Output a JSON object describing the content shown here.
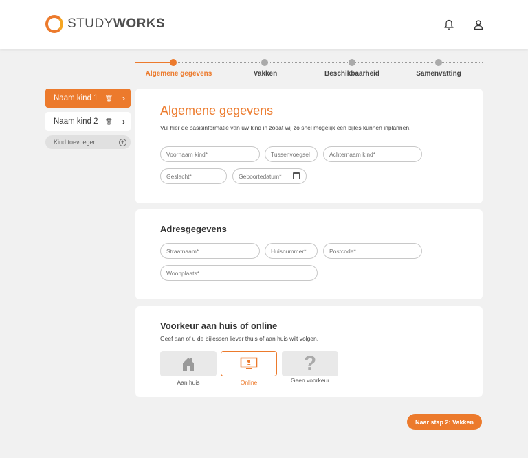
{
  "brand": {
    "name_light": "STUDY",
    "name_bold": "WORKS",
    "accent": "#ec7a2c"
  },
  "header": {
    "icons": [
      "bell-icon",
      "user-icon"
    ]
  },
  "stepper": {
    "steps": [
      {
        "label": "Algemene gegevens",
        "active": true
      },
      {
        "label": "Vakken",
        "active": false
      },
      {
        "label": "Beschikbaarheid",
        "active": false
      },
      {
        "label": "Samenvatting",
        "active": false
      }
    ]
  },
  "sidebar": {
    "kids": [
      {
        "label": "Naam kind 1",
        "active": true
      },
      {
        "label": "Naam kind 2",
        "active": false
      }
    ],
    "add_label": "Kind toevoegen"
  },
  "general": {
    "title": "Algemene gegevens",
    "description": "Vul hier de basisinformatie van uw kind in zodat wij zo snel mogelijk een bijles kunnen inplannen.",
    "fields": {
      "voornaam": "Voornaam kind*",
      "tussenvoegsel": "Tussenvoegsel",
      "achternaam": "Achternaam kind*",
      "geslacht": "Geslacht*",
      "geboortedatum": "Geboortedatum*"
    }
  },
  "address": {
    "title": "Adresgegevens",
    "fields": {
      "straatnaam": "Straatnaam*",
      "huisnummer": "Huisnummer*",
      "postcode": "Postcode*",
      "woonplaats": "Woonplaats*"
    }
  },
  "preference": {
    "title": "Voorkeur aan huis of online",
    "description": "Geef aan of u de bijlessen liever thuis of aan huis wilt volgen.",
    "options": [
      {
        "label": "Aan huis",
        "icon": "house-icon",
        "selected": false
      },
      {
        "label": "Online",
        "icon": "monitor-icon",
        "selected": true
      },
      {
        "label": "Geen voorkeur",
        "icon": "question-icon",
        "selected": false,
        "glyph": "?"
      }
    ]
  },
  "actions": {
    "next_label": "Naar stap 2: Vakken"
  }
}
